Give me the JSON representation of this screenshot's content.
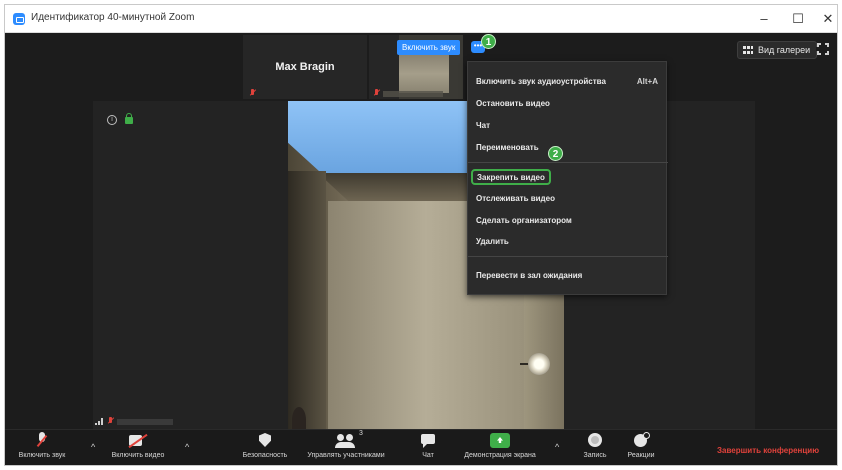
{
  "window": {
    "title": "Идентификатор 40-минутной Zoom",
    "minimize": "–",
    "maximize": "☐",
    "close": "✕"
  },
  "view": {
    "gallery_label": "Вид галереи",
    "fullscreen_icon": "fullscreen-icon"
  },
  "thumbnails": [
    {
      "name": "Max Bragin",
      "muted": true
    },
    {
      "name": "",
      "muted": true
    }
  ],
  "tooltip": {
    "unmute": "Включить звук",
    "more": "•••"
  },
  "badges": [
    "1",
    "2"
  ],
  "menu": {
    "items": [
      {
        "label": "Включить звук аудиоустройства",
        "shortcut": "Alt+A"
      },
      {
        "label": "Остановить видео"
      },
      {
        "label": "Чат"
      },
      {
        "label": "Переименовать"
      },
      {
        "label": "Закрепить видео",
        "highlighted": true
      },
      {
        "label": "Отслеживать видео"
      },
      {
        "label": "Сделать организатором"
      },
      {
        "label": "Удалить"
      },
      {
        "label": "Перевести в зал ожидания"
      }
    ]
  },
  "toolbar": {
    "unmute": "Включить звук",
    "start_video": "Включить видео",
    "security": "Безопасность",
    "participants": "Управлять участниками",
    "participants_count": "3",
    "chat": "Чат",
    "share": "Демонстрация экрана",
    "record": "Запись",
    "reactions": "Реакции",
    "end": "Завершить конференцию",
    "caret": "^"
  },
  "colors": {
    "accent_blue": "#2d8cff",
    "badge_green": "#3fae49",
    "end_red": "#e0423b"
  }
}
